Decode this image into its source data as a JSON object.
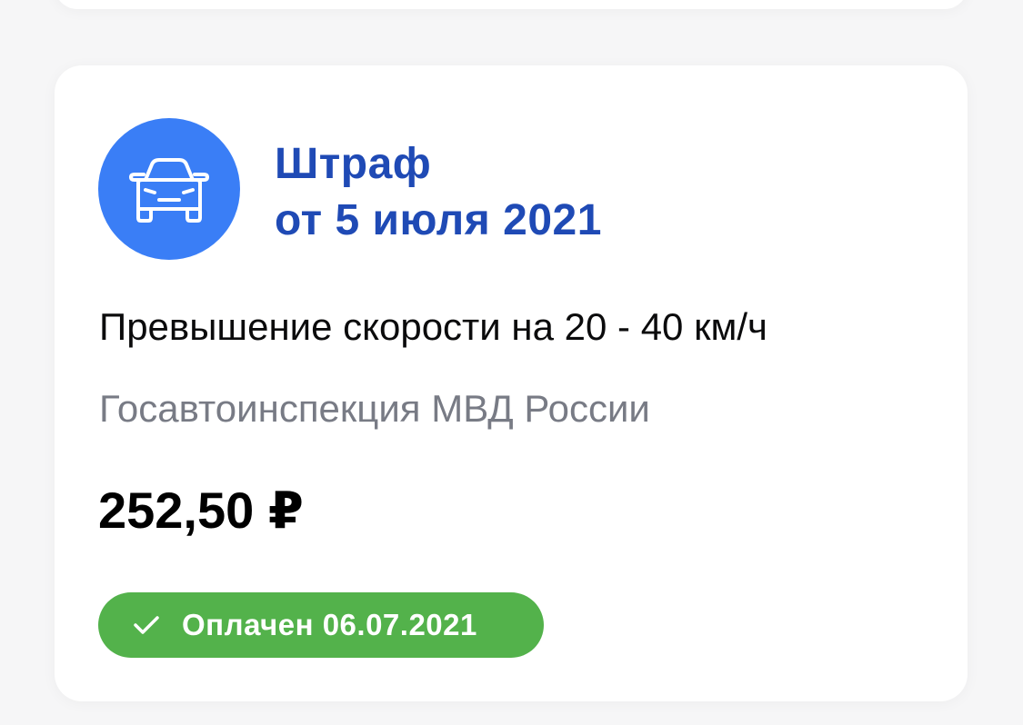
{
  "fine": {
    "icon": "car-icon",
    "title_line1": "Штраф",
    "title_line2": "от 5 июля 2021",
    "description": "Превышение скорости на 20 - 40 км/ч",
    "organization": "Госавтоинспекция МВД России",
    "amount": "252,50 ₽",
    "status": {
      "icon": "check-icon",
      "label": "Оплачен 06.07.2021",
      "color": "#53b24b"
    }
  },
  "colors": {
    "accent": "#3a7ef6",
    "title": "#1f4ab5",
    "secondary_text": "#787b85",
    "background": "#f6f6f7"
  }
}
